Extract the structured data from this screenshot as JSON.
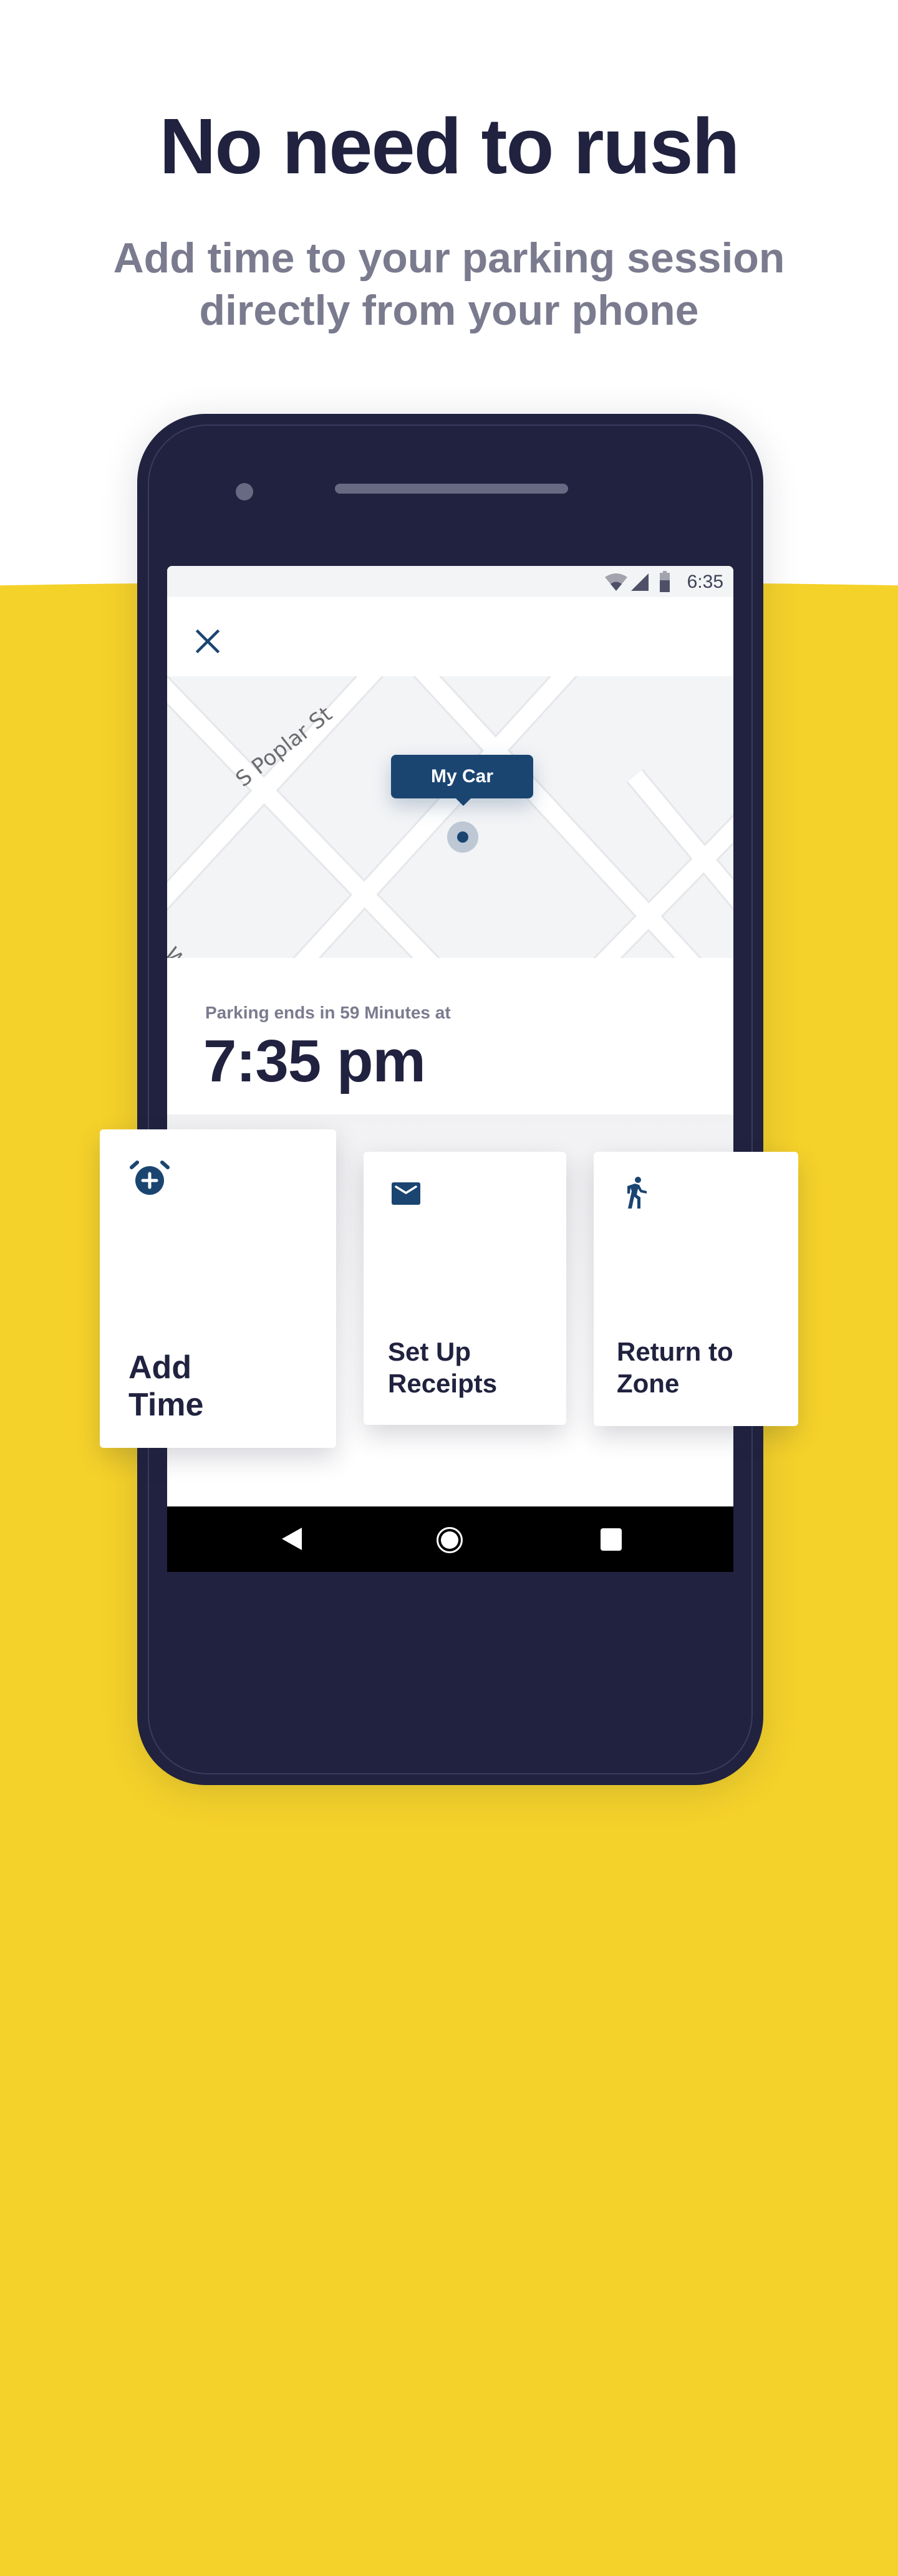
{
  "header": {
    "title": "No need to rush",
    "subtitle_line1": "Add time to your parking session",
    "subtitle_line2": "directly from your phone"
  },
  "colors": {
    "navy": "#20223f",
    "accent_blue": "#1a4571",
    "yellow": "#f5d22a",
    "muted_text": "#7b7b8f"
  },
  "status_bar": {
    "time": "6:35",
    "icons": [
      "wifi-icon",
      "cell-signal-icon",
      "battery-icon"
    ]
  },
  "top_bar": {
    "close_icon": "close-icon"
  },
  "map": {
    "street_labels": [
      "S Poplar St",
      "W S"
    ],
    "marker_label": "My Car"
  },
  "parking": {
    "ends_label": "Parking ends in 59 Minutes at",
    "end_time": "7:35 pm"
  },
  "actions": [
    {
      "icon": "alarm-add-icon",
      "line1": "Add",
      "line2": "Time"
    },
    {
      "icon": "mail-icon",
      "line1": "Set Up",
      "line2": "Receipts"
    },
    {
      "icon": "walk-icon",
      "line1": "Return to",
      "line2": "Zone"
    }
  ],
  "nav_bar": {
    "buttons": [
      "back",
      "home",
      "recents"
    ]
  }
}
